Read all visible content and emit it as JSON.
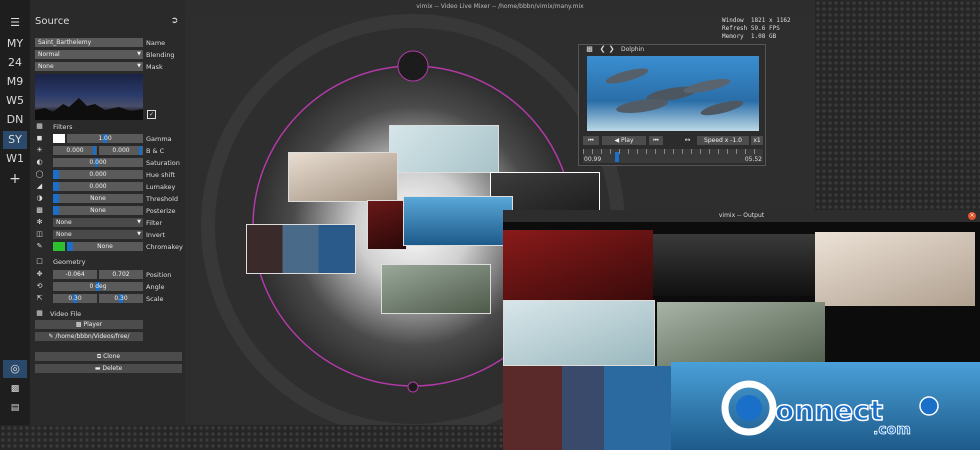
{
  "window": {
    "title": "vimix -- Video Live Mixer -- /home/bbbn/vimix/many.mix"
  },
  "stats": {
    "window_label": "Window",
    "window_value": "1821 x 1162",
    "refresh_label": "Refresh",
    "refresh_value": "59.6 FPS",
    "memory_label": "Memory",
    "memory_value": "1.08 GB"
  },
  "sidebar": {
    "sessions": [
      "MY",
      "24",
      "M9",
      "W5",
      "DN",
      "SY",
      "W1"
    ],
    "active": "SY",
    "add_label": "+"
  },
  "source_panel": {
    "title": "Source",
    "name_value": "Saint_Barthelemy",
    "name_label": "Name",
    "blending_value": "Normal",
    "blending_label": "Blending",
    "mask_value": "None",
    "mask_label": "Mask",
    "filters_header": "Filters",
    "gamma_value": "1.00",
    "gamma_label": "Gamma",
    "bc_value1": "0.000",
    "bc_value2": "0.000",
    "bc_label": "B & C",
    "saturation_value": "0.000",
    "saturation_label": "Saturation",
    "hue_value": "0.000",
    "hue_label": "Hue shift",
    "lumakey_value": "0.000",
    "lumakey_label": "Lumakey",
    "threshold_value": "None",
    "threshold_label": "Threshold",
    "posterize_value": "None",
    "posterize_label": "Posterize",
    "filter_value": "None",
    "filter_label": "Filter",
    "invert_value": "None",
    "invert_label": "Invert",
    "chromakey_value": "None",
    "chromakey_label": "Chromakey",
    "geometry_header": "Geometry",
    "pos_x": "-0.064",
    "pos_y": "0.702",
    "position_label": "Position",
    "angle_value": "0 deg",
    "angle_label": "Angle",
    "scale_x": "0.30",
    "scale_y": "0.30",
    "scale_label": "Scale",
    "videofile_header": "Video File",
    "player_button": "Player",
    "path_button": "/home/bbbn/Videos/free/",
    "clone_button": "Clone",
    "delete_button": "Delete"
  },
  "player": {
    "title": "Dolphin",
    "play_label": "Play",
    "speed_label": "Speed x -1.0",
    "loop_label": "x1",
    "time_start": "00.99",
    "time_end": "05.52",
    "progress": 0.18
  },
  "output": {
    "title": "vimix -- Output"
  }
}
